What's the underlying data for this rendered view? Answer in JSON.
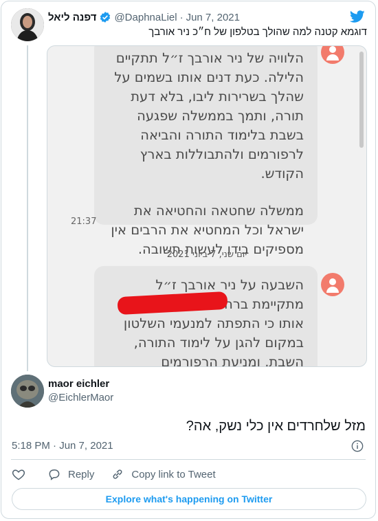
{
  "quoted": {
    "name": "דפנה ליאל",
    "handle": "@DaphnaLiel",
    "date": "Jun 7, 2021",
    "text": "דוגמא קטנה למה שהולך בטלפון של ח״כ ניר אורבך",
    "screenshot": {
      "bubble1": "הלוויה של ניר אורבך ז״ל תתקיים הלילה. כעת דנים אותו בשמים על שהלך בשרירות ליבו, בלא דעת תורה, ותמך בממשלה שפגעה בשבת בלימוד התורה והביאה לרפורמים ולהתבוללות בארץ הקודש.",
      "bubble1b": "ממשלה שחטאה והחטיאה את ישראל וכל המחטיא את הרבים אין מספיקים בידו לעשות תשובה.",
      "time": "21:37",
      "date_separator": "יום שני, 7 ביוני 2021",
      "bubble2": "השבעה על ניר אורבך ז״ל מתקיימת ברחוב א בשמיים דנים אותו כי התפתה למנעמי השלטון במקום להגן על לימוד התורה, השבת, ומניעת הרפורמים וההתבוללות"
    }
  },
  "tweet": {
    "name": "maor eichler",
    "handle": "@EichlerMaor",
    "text": "מזל שלחרדים אין כלי נשק, אה?",
    "timestamp": "5:18 PM · Jun 7, 2021"
  },
  "actions": {
    "reply": "Reply",
    "copy_link": "Copy link to Tweet"
  },
  "explore_label": "Explore what's happening on Twitter",
  "colors": {
    "twitter_blue": "#1d9bf0",
    "redaction": "#e8141a",
    "chat_avatar": "#f27b6c"
  }
}
